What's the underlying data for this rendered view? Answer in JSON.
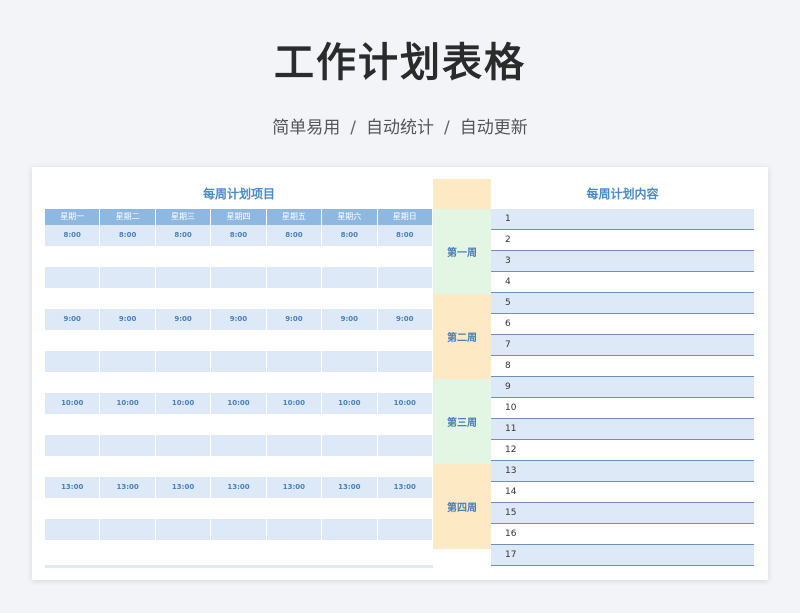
{
  "title": "工作计划表格",
  "subtitle": {
    "items": [
      "简单易用",
      "自动统计",
      "自动更新"
    ],
    "separator": "/"
  },
  "left": {
    "title": "每周计划项目",
    "days": [
      "星期一",
      "星期二",
      "星期三",
      "星期四",
      "星期五",
      "星期六",
      "星期日"
    ],
    "times": [
      "8:00",
      "9:00",
      "10:00",
      "13:00"
    ]
  },
  "weeks": [
    "第一周",
    "第二周",
    "第三周",
    "第四周"
  ],
  "right": {
    "title": "每周计划内容",
    "numbers": [
      "1",
      "2",
      "3",
      "4",
      "5",
      "6",
      "7",
      "8",
      "9",
      "10",
      "11",
      "12",
      "13",
      "14",
      "15",
      "16",
      "17"
    ]
  }
}
